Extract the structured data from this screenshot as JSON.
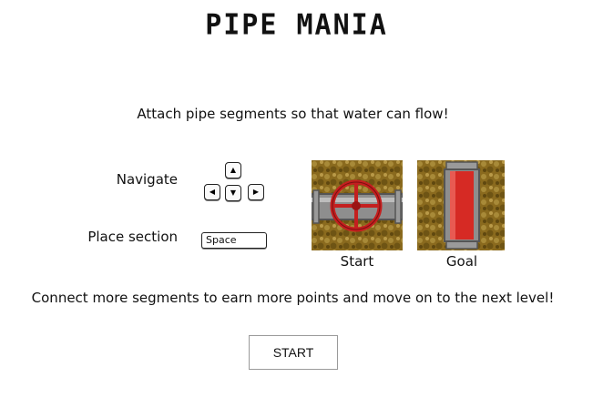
{
  "title": "PIPE MANIA",
  "intro": "Attach pipe segments so that water can flow!",
  "controls": {
    "navigate_label": "Navigate",
    "place_label": "Place section",
    "keys": {
      "up": "▲",
      "left": "◀",
      "down": "▼",
      "right": "▶",
      "space": "Space"
    }
  },
  "tiles": {
    "start_caption": "Start",
    "goal_caption": "Goal"
  },
  "connect_text": "Connect more segments to earn more points and move on to the next level!",
  "start_button": "START",
  "colors": {
    "dirt": "#8a6a1e",
    "pipe": "#8e8e8e",
    "valve": "#c41f1f"
  }
}
